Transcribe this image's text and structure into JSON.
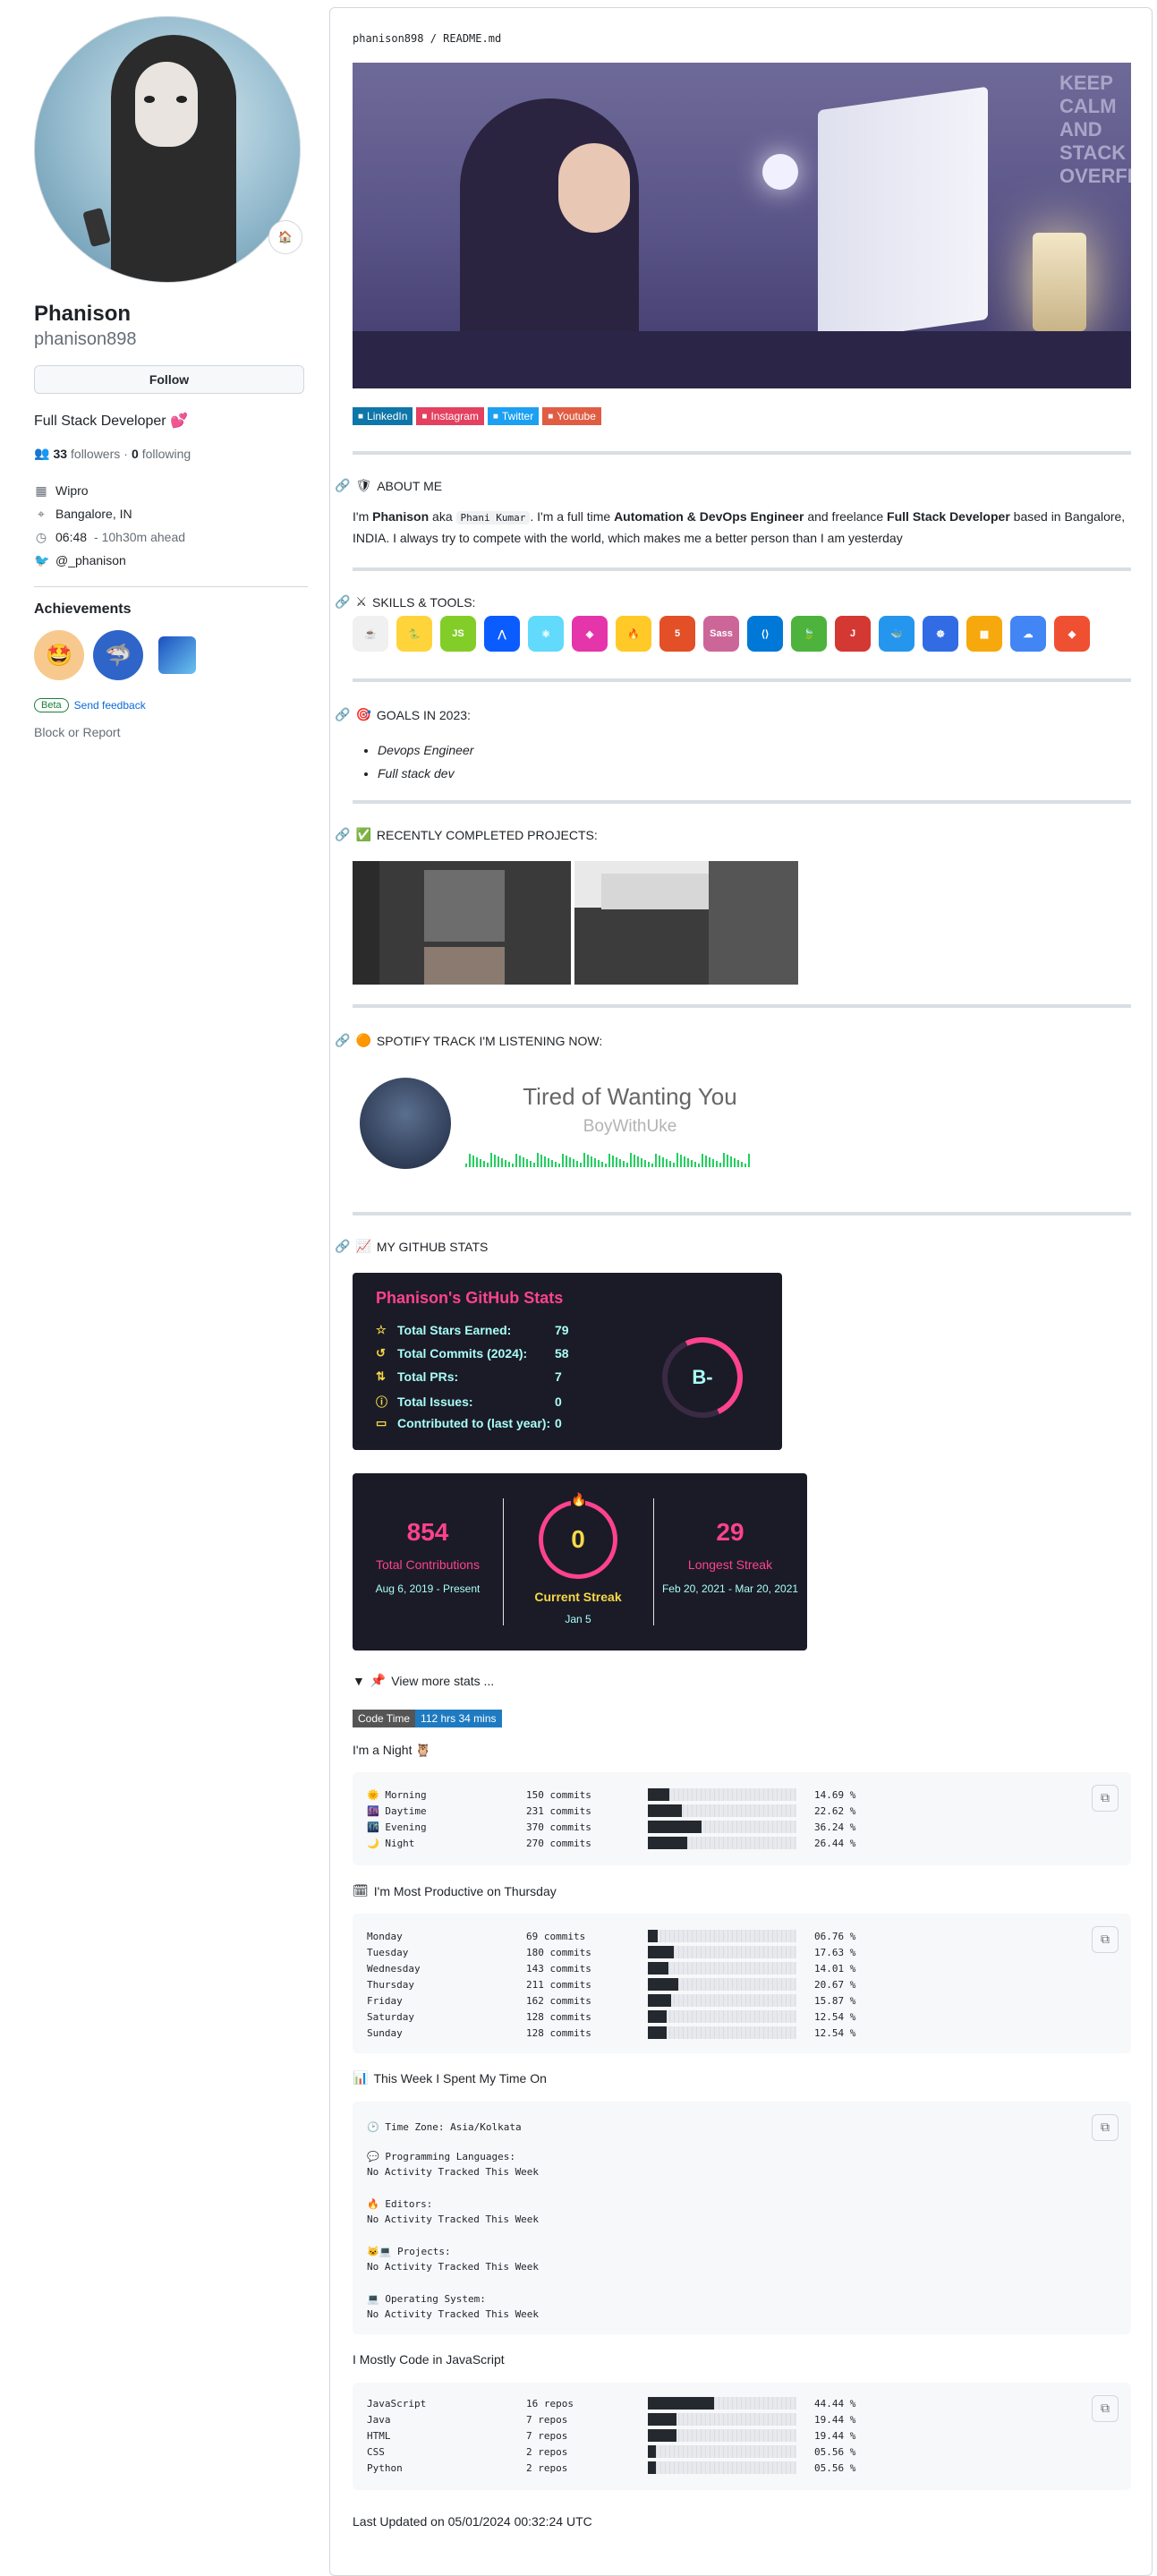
{
  "profile": {
    "name": "Phanison",
    "login": "phanison898",
    "follow_label": "Follow",
    "bio": "Full Stack Developer 💕",
    "followers_count": "33",
    "followers_label": "followers",
    "following_count": "0",
    "following_label": "following",
    "company": "Wipro",
    "location": "Bangalore, IN",
    "local_time": "06:48",
    "time_offset": "- 10h30m ahead",
    "twitter": "@_phanison",
    "status_emoji": "🏠"
  },
  "achievements": {
    "title": "Achievements",
    "beta_label": "Beta",
    "feedback_label": "Send feedback",
    "block_label": "Block or Report"
  },
  "readme": {
    "crumb": "phanison898 / README.md",
    "banner_text": "KEEP CALM AND STACK OVERFLOW",
    "social": [
      {
        "label": "LinkedIn",
        "color": "#0e76a8",
        "icon": "linkedin-icon"
      },
      {
        "label": "Instagram",
        "color": "#e4405f",
        "icon": "instagram-icon"
      },
      {
        "label": "Twitter",
        "color": "#1ca0f2",
        "icon": "twitter-icon"
      },
      {
        "label": "Youtube",
        "color": "#e05d44",
        "icon": "youtube-icon"
      }
    ],
    "about_title": "ABOUT ME",
    "about_pre": "I'm",
    "about_name": "Phanison",
    "about_aka": "aka",
    "about_code": "Phani Kumar",
    "about_mid": ". I'm a full time",
    "about_bold1": "Automation & DevOps Engineer",
    "about_and": "and freelance",
    "about_bold2": "Full Stack Developer",
    "about_post": "based in Bangalore, INDIA. I always try to compete with the world, which makes me a better person than I am yesterday",
    "skills_title": "SKILLS & TOOLS:",
    "skills": [
      {
        "name": "java",
        "color": "#f0f0f0",
        "glyph": "☕"
      },
      {
        "name": "python",
        "color": "#ffd43b",
        "glyph": "🐍"
      },
      {
        "name": "nodejs",
        "color": "#83cd29",
        "glyph": "JS"
      },
      {
        "name": "angular",
        "color": "#0b5cff",
        "glyph": "⋀"
      },
      {
        "name": "react",
        "color": "#61dafb",
        "glyph": "⚛"
      },
      {
        "name": "graphql",
        "color": "#e535ab",
        "glyph": "◈"
      },
      {
        "name": "firebase",
        "color": "#ffca28",
        "glyph": "🔥"
      },
      {
        "name": "html5",
        "color": "#e34f26",
        "glyph": "5"
      },
      {
        "name": "sass",
        "color": "#cc6699",
        "glyph": "Sass"
      },
      {
        "name": "vscode",
        "color": "#0078d7",
        "glyph": "⟨⟩"
      },
      {
        "name": "mongodb",
        "color": "#4db33d",
        "glyph": "🍃"
      },
      {
        "name": "jenkins",
        "color": "#d33833",
        "glyph": "J"
      },
      {
        "name": "docker",
        "color": "#2496ed",
        "glyph": "🐳"
      },
      {
        "name": "kubernetes",
        "color": "#326ce5",
        "glyph": "☸"
      },
      {
        "name": "aws",
        "color": "#f7a80d",
        "glyph": "▦"
      },
      {
        "name": "gcp",
        "color": "#4285f4",
        "glyph": "☁"
      },
      {
        "name": "git",
        "color": "#f05032",
        "glyph": "◆"
      }
    ],
    "goals_title": "GOALS IN 2023:",
    "goals": [
      "Devops Engineer",
      "Full stack dev"
    ],
    "projects_title": "RECENTLY COMPLETED PROJECTS:",
    "spotify_title": "SPOTIFY TRACK I'M LISTENING NOW:",
    "spotify_track": "Tired of Wanting You",
    "spotify_artist": "BoyWithUke",
    "stats_title": "MY GITHUB STATS",
    "gh_card": {
      "title": "Phanison's GitHub Stats",
      "rows": [
        {
          "label": "Total Stars Earned:",
          "value": "79",
          "icon": "star-icon",
          "glyph": "☆"
        },
        {
          "label": "Total Commits (2024):",
          "value": "58",
          "icon": "history-icon",
          "glyph": "↺"
        },
        {
          "label": "Total PRs:",
          "value": "7",
          "icon": "pull-request-icon",
          "glyph": "⇅"
        },
        {
          "label": "Total Issues:",
          "value": "0",
          "icon": "issue-icon",
          "glyph": "ⓘ"
        },
        {
          "label": "Contributed to (last year):",
          "value": "0",
          "icon": "repo-icon",
          "glyph": "▭"
        }
      ],
      "grade": "B-"
    },
    "streak": {
      "total": "854",
      "total_label": "Total Contributions",
      "total_range": "Aug 6, 2019 - Present",
      "current": "0",
      "current_label": "Current Streak",
      "current_range": "Jan 5",
      "longest": "29",
      "longest_label": "Longest Streak",
      "longest_range": "Feb 20, 2021 - Mar 20, 2021"
    },
    "view_more": "View more stats ...",
    "codetime_label": "Code Time",
    "codetime_value": "112 hrs 34 mins",
    "night_title": "I'm a Night 🦉",
    "day_rows": [
      {
        "emoji": "🌞",
        "name": "Morning",
        "count": "150 commits",
        "pct": 14.69,
        "pct_label": "14.69 %"
      },
      {
        "emoji": "🌆",
        "name": "Daytime",
        "count": "231 commits",
        "pct": 22.62,
        "pct_label": "22.62 %"
      },
      {
        "emoji": "🌃",
        "name": "Evening",
        "count": "370 commits",
        "pct": 36.24,
        "pct_label": "36.24 %"
      },
      {
        "emoji": "🌙",
        "name": "Night",
        "count": "270 commits",
        "pct": 26.44,
        "pct_label": "26.44 %"
      }
    ],
    "week_title": "I'm Most Productive on Thursday",
    "week_rows": [
      {
        "name": "Monday",
        "count": "69 commits",
        "pct": 6.76,
        "pct_label": "06.76 %"
      },
      {
        "name": "Tuesday",
        "count": "180 commits",
        "pct": 17.63,
        "pct_label": "17.63 %"
      },
      {
        "name": "Wednesday",
        "count": "143 commits",
        "pct": 14.01,
        "pct_label": "14.01 %"
      },
      {
        "name": "Thursday",
        "count": "211 commits",
        "pct": 20.67,
        "pct_label": "20.67 %"
      },
      {
        "name": "Friday",
        "count": "162 commits",
        "pct": 15.87,
        "pct_label": "15.87 %"
      },
      {
        "name": "Saturday",
        "count": "128 commits",
        "pct": 12.54,
        "pct_label": "12.54 %"
      },
      {
        "name": "Sunday",
        "count": "128 commits",
        "pct": 12.54,
        "pct_label": "12.54 %"
      }
    ],
    "time_title": "This Week I Spent My Time On",
    "time_lines": {
      "tz": "Time Zone: Asia/Kolkata",
      "lang": "Programming Languages:",
      "editors": "Editors:",
      "projects": "Projects:",
      "os": "Operating System:",
      "none": "No Activity Tracked This Week"
    },
    "lang_title": "I Mostly Code in JavaScript",
    "lang_rows": [
      {
        "name": "JavaScript",
        "count": "16 repos",
        "pct": 44.44,
        "pct_label": "44.44 %"
      },
      {
        "name": "Java",
        "count": "7 repos",
        "pct": 19.44,
        "pct_label": "19.44 %"
      },
      {
        "name": "HTML",
        "count": "7 repos",
        "pct": 19.44,
        "pct_label": "19.44 %"
      },
      {
        "name": "CSS",
        "count": "2 repos",
        "pct": 5.56,
        "pct_label": "05.56 %"
      },
      {
        "name": "Python",
        "count": "2 repos",
        "pct": 5.56,
        "pct_label": "05.56 %"
      }
    ],
    "updated": "Last Updated on 05/01/2024 00:32:24 UTC"
  }
}
